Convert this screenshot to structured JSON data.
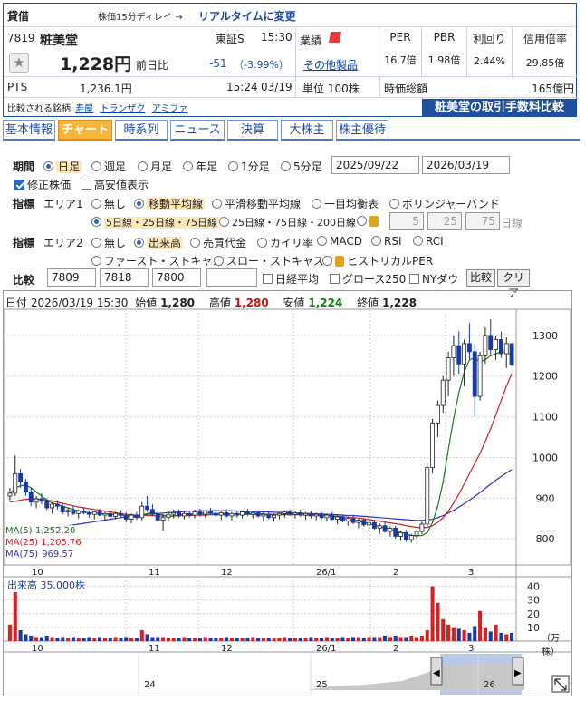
{
  "quote": {
    "tag": "貸借",
    "delay_note": "株価15分ディレイ →",
    "realtime_link": "リアルタイムに変更",
    "code": "7819",
    "name": "粧美堂",
    "market": "東証S",
    "time": "15:30",
    "price": "1,228円",
    "prev_label": "前日比",
    "change": "-51",
    "change_pct": "（-3.99%）",
    "pts_label": "PTS",
    "pts_price": "1,236.1円",
    "pts_time": "15:24",
    "pts_date": "03/19",
    "compare_label": "比較される銘柄",
    "compare_links": [
      "寿屋",
      "トランザク",
      "アミファ"
    ],
    "sector_label": "業績",
    "other_products": "その他製品",
    "unit": "単位 100株",
    "metrics": [
      {
        "label": "PER",
        "value": "16.7倍"
      },
      {
        "label": "PBR",
        "value": "1.98倍"
      },
      {
        "label": "利回り",
        "value": "2.44%"
      },
      {
        "label": "信用倍率",
        "value": "29.85倍"
      }
    ],
    "mcap_label": "時価総額",
    "mcap_value": "165億円",
    "fee_banner": "粧美堂の取引手数料比較"
  },
  "tabs": [
    "基本情報",
    "チャート",
    "時系列",
    "ニュース",
    "決算",
    "大株主",
    "株主優待"
  ],
  "controls": {
    "period_label": "期間",
    "periods": [
      "日足",
      "週足",
      "月足",
      "年足",
      "1分足",
      "5分足"
    ],
    "date_from": "2025/09/22",
    "date_to": "2026/03/19",
    "adjusted": "修正株価",
    "highlow": "高安値表示",
    "ind_label": "指標",
    "area1": "エリア1",
    "area1_opts": [
      "無し",
      "移動平均線",
      "平滑移動平均線",
      "一目均衡表",
      "ボリンジャーバンド"
    ],
    "ma_opts": [
      "5日線・25日線・75日線",
      "25日線・75日線・200日線"
    ],
    "ma_custom": [
      "5",
      "25",
      "75"
    ],
    "ma_unit": "日線",
    "area2": "エリア2",
    "area2_opts": [
      "無し",
      "出来高",
      "売買代金",
      "カイリ率",
      "MACD",
      "RSI",
      "RCI"
    ],
    "area2_opts2": [
      "ファースト・ストキャス",
      "スロー・ストキャス",
      "ヒストリカルPER"
    ],
    "cmp_label": "比較",
    "cmp_codes": [
      "7809",
      "7818",
      "7800",
      ""
    ],
    "cmp_checks": [
      "日経平均",
      "グロース250",
      "NYダウ"
    ],
    "cmp_btn": "比較",
    "clear_btn": "クリア"
  },
  "chart_data": {
    "type": "candlestick",
    "header": {
      "date_label": "日付",
      "date": "2026/03/19 15:30",
      "open_label": "始値",
      "open": "1,280",
      "high_label": "高値",
      "high": "1,280",
      "low_label": "安値",
      "low": "1,224",
      "close_label": "終値",
      "close": "1,228"
    },
    "y_ticks": [
      800,
      900,
      1000,
      1100,
      1200,
      1300
    ],
    "ylim": [
      740,
      1360
    ],
    "x_ticks": [
      "10",
      "11",
      "12",
      "26/1",
      "2",
      "3"
    ],
    "ma_legend": [
      {
        "name": "MA(5)",
        "value": "1,252.20",
        "color": "#1a7a1a"
      },
      {
        "name": "MA(25)",
        "value": "1,205.76",
        "color": "#d02020"
      },
      {
        "name": "MA(75)",
        "value": "969.57",
        "color": "#3030c0"
      }
    ],
    "ohlc": [
      [
        905,
        925,
        895,
        912
      ],
      [
        912,
        1005,
        905,
        960
      ],
      [
        960,
        972,
        925,
        940
      ],
      [
        940,
        948,
        905,
        915
      ],
      [
        915,
        925,
        880,
        890
      ],
      [
        890,
        905,
        875,
        898
      ],
      [
        898,
        912,
        885,
        892
      ],
      [
        892,
        900,
        870,
        876
      ],
      [
        876,
        890,
        862,
        885
      ],
      [
        885,
        895,
        872,
        880
      ],
      [
        880,
        888,
        860,
        866
      ],
      [
        866,
        875,
        855,
        870
      ],
      [
        870,
        880,
        858,
        862
      ],
      [
        862,
        872,
        850,
        868
      ],
      [
        868,
        878,
        860,
        864
      ],
      [
        864,
        870,
        852,
        860
      ],
      [
        860,
        868,
        848,
        866
      ],
      [
        866,
        874,
        856,
        858
      ],
      [
        858,
        866,
        845,
        862
      ],
      [
        862,
        870,
        848,
        855
      ],
      [
        855,
        866,
        848,
        862
      ],
      [
        862,
        870,
        852,
        858
      ],
      [
        858,
        866,
        840,
        848
      ],
      [
        848,
        862,
        838,
        858
      ],
      [
        858,
        866,
        846,
        852
      ],
      [
        852,
        890,
        845,
        880
      ],
      [
        880,
        905,
        866,
        872
      ],
      [
        872,
        885,
        855,
        860
      ],
      [
        860,
        870,
        840,
        846
      ],
      [
        846,
        860,
        820,
        852
      ],
      [
        852,
        868,
        845,
        860
      ],
      [
        860,
        872,
        850,
        864
      ],
      [
        864,
        872,
        852,
        856
      ],
      [
        856,
        868,
        848,
        862
      ],
      [
        862,
        870,
        852,
        858
      ],
      [
        858,
        872,
        850,
        866
      ],
      [
        866,
        874,
        854,
        860
      ],
      [
        860,
        870,
        852,
        868
      ],
      [
        868,
        876,
        858,
        862
      ],
      [
        862,
        872,
        850,
        858
      ],
      [
        858,
        868,
        846,
        864
      ],
      [
        864,
        872,
        852,
        856
      ],
      [
        856,
        866,
        846,
        862
      ],
      [
        862,
        870,
        852,
        858
      ],
      [
        858,
        870,
        850,
        866
      ],
      [
        866,
        874,
        856,
        860
      ],
      [
        860,
        868,
        850,
        864
      ],
      [
        864,
        870,
        852,
        856
      ],
      [
        856,
        866,
        842,
        860
      ],
      [
        860,
        868,
        848,
        852
      ],
      [
        852,
        862,
        842,
        858
      ],
      [
        858,
        866,
        848,
        862
      ],
      [
        862,
        870,
        852,
        866
      ],
      [
        866,
        872,
        856,
        860
      ],
      [
        860,
        868,
        850,
        864
      ],
      [
        864,
        872,
        854,
        858
      ],
      [
        858,
        866,
        846,
        862
      ],
      [
        862,
        868,
        850,
        856
      ],
      [
        856,
        864,
        846,
        860
      ],
      [
        860,
        866,
        848,
        852
      ],
      [
        852,
        862,
        842,
        858
      ],
      [
        858,
        866,
        844,
        848
      ],
      [
        848,
        858,
        836,
        854
      ],
      [
        854,
        860,
        840,
        844
      ],
      [
        844,
        854,
        832,
        850
      ],
      [
        850,
        858,
        836,
        840
      ],
      [
        840,
        850,
        826,
        846
      ],
      [
        846,
        852,
        830,
        834
      ],
      [
        834,
        844,
        820,
        840
      ],
      [
        840,
        846,
        822,
        826
      ],
      [
        826,
        838,
        812,
        832
      ],
      [
        832,
        840,
        815,
        818
      ],
      [
        818,
        830,
        805,
        826
      ],
      [
        826,
        832,
        800,
        806
      ],
      [
        806,
        820,
        795,
        815
      ],
      [
        815,
        822,
        792,
        798
      ],
      [
        798,
        812,
        790,
        808
      ],
      [
        808,
        822,
        800,
        818
      ],
      [
        818,
        842,
        812,
        836
      ],
      [
        836,
        985,
        830,
        975
      ],
      [
        975,
        1095,
        960,
        1085
      ],
      [
        1085,
        1140,
        1050,
        1128
      ],
      [
        1128,
        1200,
        1110,
        1190
      ],
      [
        1190,
        1260,
        1150,
        1245
      ],
      [
        1245,
        1300,
        1200,
        1275
      ],
      [
        1275,
        1310,
        1205,
        1230
      ],
      [
        1230,
        1290,
        1175,
        1280
      ],
      [
        1280,
        1330,
        1240,
        1260
      ],
      [
        1260,
        1280,
        1100,
        1150
      ],
      [
        1150,
        1260,
        1140,
        1250
      ],
      [
        1250,
        1320,
        1230,
        1300
      ],
      [
        1300,
        1340,
        1250,
        1265
      ],
      [
        1265,
        1300,
        1240,
        1290
      ],
      [
        1290,
        1310,
        1245,
        1255
      ],
      [
        1255,
        1295,
        1220,
        1280
      ],
      [
        1280,
        1280,
        1224,
        1228
      ]
    ],
    "ma5": [
      910,
      925,
      930,
      932,
      925,
      915,
      905,
      895,
      888,
      884,
      880,
      876,
      872,
      868,
      866,
      864,
      863,
      862,
      861,
      860,
      859,
      858,
      857,
      855,
      854,
      858,
      862,
      864,
      862,
      858,
      856,
      856,
      858,
      860,
      860,
      861,
      862,
      862,
      863,
      862,
      862,
      861,
      861,
      860,
      861,
      862,
      862,
      862,
      861,
      860,
      859,
      860,
      861,
      862,
      862,
      861,
      861,
      860,
      859,
      858,
      857,
      855,
      852,
      850,
      848,
      846,
      843,
      840,
      837,
      834,
      830,
      827,
      824,
      820,
      816,
      812,
      808,
      807,
      808,
      815,
      840,
      880,
      940,
      1020,
      1095,
      1160,
      1210,
      1240,
      1245,
      1235,
      1240,
      1250,
      1255,
      1260,
      1258,
      1252
    ],
    "ma25": [
      890,
      892,
      895,
      897,
      898,
      898,
      897,
      895,
      893,
      890,
      887,
      884,
      881,
      878,
      876,
      874,
      872,
      870,
      868,
      866,
      864,
      862,
      860,
      859,
      858,
      858,
      857,
      857,
      856,
      856,
      856,
      856,
      857,
      857,
      857,
      858,
      858,
      858,
      859,
      859,
      859,
      860,
      860,
      860,
      860,
      860,
      860,
      860,
      860,
      860,
      860,
      859,
      859,
      859,
      859,
      859,
      858,
      858,
      858,
      857,
      857,
      856,
      855,
      854,
      853,
      852,
      851,
      849,
      847,
      845,
      843,
      841,
      839,
      837,
      835,
      832,
      830,
      828,
      827,
      828,
      832,
      840,
      852,
      868,
      888,
      910,
      935,
      960,
      985,
      1010,
      1040,
      1070,
      1105,
      1140,
      1175,
      1206
    ],
    "ma75": [
      810,
      812,
      814,
      816,
      818,
      820,
      822,
      824,
      826,
      828,
      830,
      832,
      834,
      836,
      838,
      840,
      842,
      844,
      846,
      848,
      850,
      852,
      854,
      856,
      857,
      858,
      860,
      861,
      862,
      863,
      864,
      865,
      866,
      867,
      868,
      868,
      869,
      869,
      869,
      869,
      869,
      869,
      869,
      868,
      868,
      868,
      867,
      867,
      866,
      866,
      865,
      865,
      864,
      864,
      863,
      863,
      862,
      862,
      861,
      861,
      860,
      860,
      859,
      858,
      857,
      857,
      856,
      855,
      854,
      853,
      852,
      851,
      850,
      849,
      848,
      847,
      846,
      845,
      845,
      846,
      848,
      852,
      857,
      863,
      870,
      878,
      886,
      895,
      904,
      914,
      924,
      934,
      944,
      953,
      962,
      970
    ],
    "volume": {
      "label": "出来高",
      "scale_note": "35,000株",
      "unit": "（万株）",
      "y_ticks": [
        10,
        20,
        30,
        40
      ],
      "ylim": [
        0,
        45
      ],
      "values": [
        12,
        38,
        8,
        5,
        4,
        3,
        3,
        4,
        3,
        2,
        3,
        2,
        3,
        2,
        2,
        3,
        2,
        3,
        2,
        2,
        3,
        2,
        3,
        2,
        2,
        8,
        5,
        3,
        3,
        3,
        2,
        2,
        2,
        3,
        2,
        2,
        2,
        3,
        2,
        2,
        2,
        3,
        2,
        2,
        2,
        2,
        3,
        2,
        2,
        2,
        2,
        2,
        3,
        2,
        2,
        2,
        2,
        3,
        2,
        2,
        3,
        2,
        2,
        3,
        2,
        3,
        3,
        2,
        3,
        3,
        3,
        4,
        3,
        4,
        3,
        3,
        4,
        3,
        4,
        8,
        40,
        28,
        16,
        12,
        10,
        9,
        8,
        6,
        11,
        22,
        10,
        7,
        12,
        6,
        5,
        6
      ]
    },
    "navigator_labels": [
      "24",
      "25",
      "26"
    ]
  }
}
